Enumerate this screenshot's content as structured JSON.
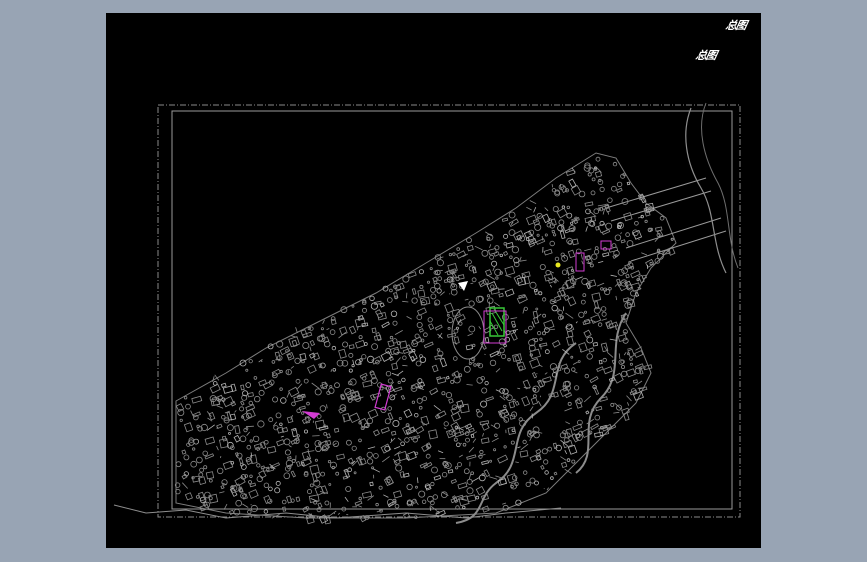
{
  "drawing": {
    "title_mark_1": "总图",
    "title_mark_2": "总图",
    "background_color": "#000000",
    "linework_color": "#8c8c8c",
    "highlight_colors": [
      "#d23cd2",
      "#38c838",
      "#e8e820",
      "#ffffff"
    ]
  },
  "window": {
    "frame_color": "#98a4b4"
  }
}
